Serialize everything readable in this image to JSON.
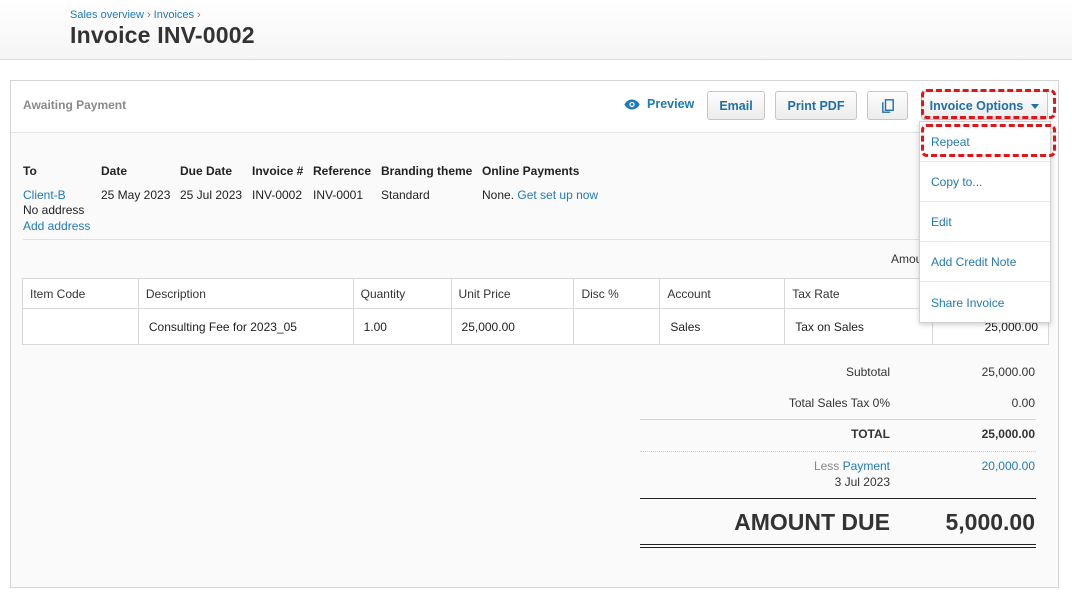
{
  "breadcrumb": {
    "item1": "Sales overview",
    "item2": "Invoices",
    "sep": "›"
  },
  "title": "Invoice INV-0002",
  "status": "Awaiting Payment",
  "toolbar": {
    "preview_label": "Preview",
    "email_label": "Email",
    "print_pdf_label": "Print PDF",
    "copy_icon": "copy-icon",
    "options_label": "Invoice Options"
  },
  "details": {
    "to_label": "To",
    "to_name": "Client-B",
    "to_address": "No address",
    "add_address": "Add address",
    "date_label": "Date",
    "date_value": "25 May 2023",
    "due_label": "Due Date",
    "due_value": "25 Jul 2023",
    "invoice_no_label": "Invoice #",
    "invoice_no_value": "INV-0002",
    "reference_label": "Reference",
    "reference_value": "INV-0001",
    "branding_label": "Branding theme",
    "branding_value": "Standard",
    "online_payments_label": "Online Payments",
    "online_payments_value": "None.",
    "setup_link": "Get set up now",
    "amounts_label": "Amou"
  },
  "table": {
    "headers": [
      "Item Code",
      "Description",
      "Quantity",
      "Unit Price",
      "Disc %",
      "Account",
      "Tax Rate"
    ],
    "rows": [
      {
        "item_code": "",
        "description": "Consulting Fee for 2023_05",
        "quantity": "1.00",
        "unit_price": "25,000.00",
        "disc": "",
        "account": "Sales",
        "tax_rate": "Tax on Sales",
        "amount": "25,000.00"
      }
    ]
  },
  "totals": {
    "subtotal_label": "Subtotal",
    "subtotal_value": "25,000.00",
    "tax_label": "Total Sales Tax 0%",
    "tax_value": "0.00",
    "total_label": "TOTAL",
    "total_value": "25,000.00",
    "less_label": "Less",
    "payment_link": "Payment",
    "payment_date": "3 Jul 2023",
    "payment_value": "20,000.00",
    "amount_due_label": "AMOUNT DUE",
    "amount_due_value": "5,000.00"
  },
  "menu": {
    "items": [
      "Repeat",
      "Copy to...",
      "Edit",
      "Add Credit Note",
      "Share Invoice"
    ]
  },
  "colors": {
    "link": "#1f7ab8",
    "highlight": "#e1141a"
  }
}
